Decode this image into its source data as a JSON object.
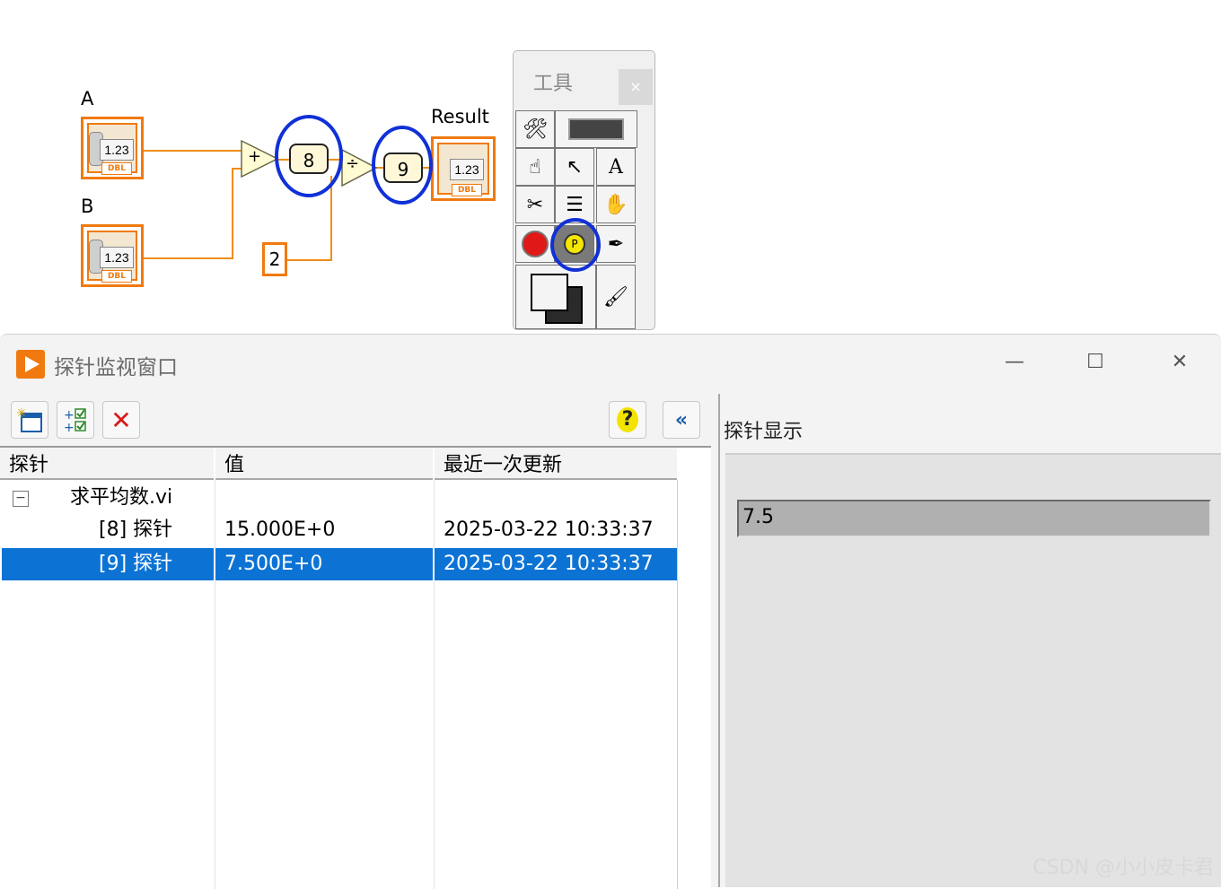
{
  "diagram": {
    "label_a": "A",
    "label_b": "B",
    "label_result": "Result",
    "control_num": "1.23",
    "control_type": "DBL",
    "add_symbol": "+",
    "divide_symbol": "÷",
    "probe_8": "8",
    "probe_9": "9",
    "constant": "2"
  },
  "palette": {
    "title": "工具",
    "close": "×"
  },
  "probe_window": {
    "title": "探针监视窗口",
    "controls": {
      "minimize": "—",
      "maximize": "☐",
      "close": "✕"
    },
    "columns": [
      "探针",
      "值",
      "最近一次更新"
    ],
    "tree_toggle": "−",
    "root": "求平均数.vi",
    "rows": [
      {
        "probe": "[8] 探针",
        "value": "15.000E+0",
        "updated": "2025-03-22 10:33:37"
      },
      {
        "probe": "[9] 探针",
        "value": "7.500E+0",
        "updated": "2025-03-22 10:33:37"
      }
    ],
    "right_title": "探针显示",
    "display_value": "7.5"
  },
  "watermark": "CSDN @小小皮卡君",
  "colors": {
    "accent": "#f07a0f",
    "selection": "#0c73d4",
    "annotation": "#1030d8"
  }
}
